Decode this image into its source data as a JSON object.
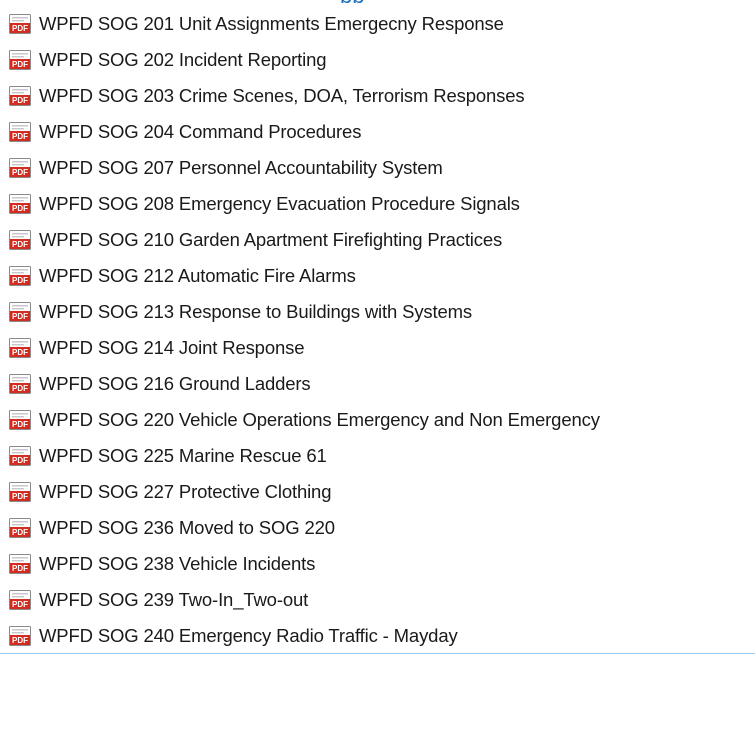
{
  "header": {
    "partial_title": "pp"
  },
  "icons": {
    "file_icon": "pdf-icon",
    "icon_color": "#d22b1f"
  },
  "files": [
    {
      "name": "WPFD SOG 201 Unit Assignments Emergecny Response"
    },
    {
      "name": "WPFD SOG 202 Incident Reporting"
    },
    {
      "name": "WPFD SOG 203 Crime Scenes, DOA, Terrorism Responses"
    },
    {
      "name": "WPFD SOG 204 Command Procedures"
    },
    {
      "name": "WPFD SOG 207 Personnel Accountability System"
    },
    {
      "name": "WPFD SOG 208 Emergency Evacuation Procedure Signals"
    },
    {
      "name": "WPFD SOG 210 Garden Apartment Firefighting Practices"
    },
    {
      "name": "WPFD SOG 212 Automatic Fire Alarms"
    },
    {
      "name": "WPFD SOG 213 Response to Buildings with Systems"
    },
    {
      "name": "WPFD SOG 214 Joint Response"
    },
    {
      "name": "WPFD SOG 216 Ground Ladders"
    },
    {
      "name": "WPFD SOG 220 Vehicle Operations Emergency and Non Emergency"
    },
    {
      "name": "WPFD SOG 225 Marine Rescue 61"
    },
    {
      "name": "WPFD SOG 227 Protective Clothing"
    },
    {
      "name": "WPFD SOG 236 Moved to SOG 220"
    },
    {
      "name": "WPFD SOG 238 Vehicle Incidents"
    },
    {
      "name": "WPFD SOG 239 Two-In_Two-out"
    },
    {
      "name": "WPFD SOG 240 Emergency Radio Traffic - Mayday"
    }
  ]
}
